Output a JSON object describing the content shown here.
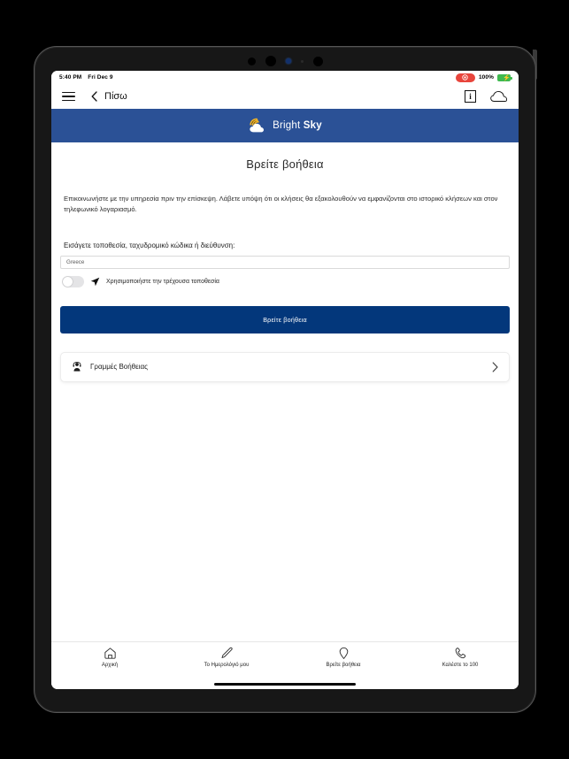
{
  "device": {
    "camera_dots": [
      "lens-large",
      "lens-large",
      "sensor-blue",
      "sensor-small",
      "lens-large"
    ]
  },
  "status_bar": {
    "time": "5:40 PM",
    "date": "Fri Dec 9",
    "recording_icon": "screen-record-icon",
    "battery_percent": "100%",
    "battery_icon": "battery-charging-icon"
  },
  "nav_bar": {
    "menu_icon": "hamburger-menu-icon",
    "back_icon": "chevron-left-icon",
    "back_label": "Πίσω",
    "info_icon": "info-box-icon",
    "cloud_icon": "cloud-icon"
  },
  "brand": {
    "logo_icon": "sun-cloud-logo-icon",
    "name_light": "Bright ",
    "name_bold": "Sky"
  },
  "main": {
    "title": "Βρείτε βοήθεια",
    "intro": "Επικοινωνήστε με την υπηρεσία πριν την επίσκεψη. Λάβετε υπόψη ότι οι κλήσεις θα εξακολουθούν να εμφανίζονται στο ιστορικό κλήσεων και στον τηλεφωνικό λογαριασμό.",
    "field_label": "Εισάγετε τοποθεσία, ταχυδρομικό κώδικα ή διεύθυνση:",
    "location_value": "Greece",
    "location_placeholder": "Greece",
    "toggle_state": "off",
    "toggle_icon": "navigation-arrow-icon",
    "toggle_label": "Χρησιμοποιήστε την τρέχουσα τοποθεσία",
    "submit_label": "Βρείτε βοήθεια",
    "helplines": {
      "icon": "support-agent-icon",
      "label": "Γραμμές Βοήθειας",
      "chevron": "chevron-right-icon"
    }
  },
  "tab_bar": {
    "active_index": 2,
    "items": [
      {
        "icon": "home-icon",
        "label": "Αρχική"
      },
      {
        "icon": "pencil-icon",
        "label": "Το Ημερολόγιό μου"
      },
      {
        "icon": "map-pin-icon",
        "label": "Βρείτε βοήθεια"
      },
      {
        "icon": "phone-icon",
        "label": "Καλέστε το 100"
      }
    ]
  },
  "colors": {
    "brand_header_blue": "#2b5196",
    "primary_button_blue": "#03377b",
    "battery_green": "#3fb94f",
    "record_red": "#e8453c"
  }
}
